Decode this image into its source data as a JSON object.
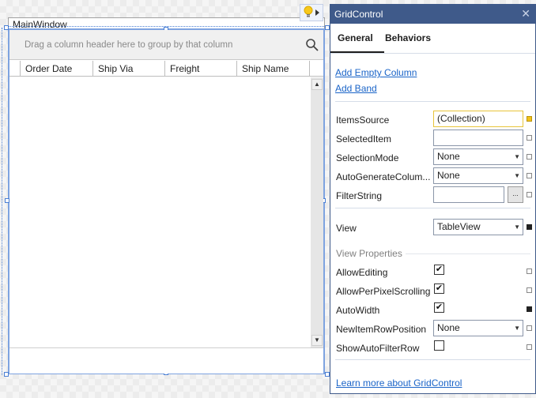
{
  "designer": {
    "window_title": "MainWindow",
    "group_panel_hint": "Drag a column header here to group by that column",
    "columns": [
      "Order Date",
      "Ship Via",
      "Freight",
      "Ship Name"
    ],
    "icons": {
      "search": "search-icon",
      "lightbulb": "lightbulb-icon",
      "expand": "triangle-right-icon",
      "scroll_up": "▲",
      "scroll_down": "▼"
    }
  },
  "panel": {
    "title": "GridControl",
    "close": "✕",
    "tabs": [
      {
        "label": "General",
        "active": true
      },
      {
        "label": "Behaviors",
        "active": false
      }
    ],
    "actions": [
      "Add Empty Column",
      "Add Band"
    ],
    "properties": [
      {
        "name": "ItemsSource",
        "value": "(Collection)",
        "editor": "text",
        "marker": "gold"
      },
      {
        "name": "SelectedItem",
        "value": "",
        "editor": "text",
        "marker": "empty"
      },
      {
        "name": "SelectionMode",
        "value": "None",
        "editor": "combo",
        "marker": "empty"
      },
      {
        "name": "AutoGenerateColum...",
        "value": "None",
        "editor": "combo",
        "marker": "empty"
      },
      {
        "name": "FilterString",
        "value": "",
        "editor": "text-ellipsis",
        "ellipsis": "...",
        "marker": "empty"
      }
    ],
    "view": {
      "name": "View",
      "value": "TableView",
      "marker": "set"
    },
    "view_properties_title": "View Properties",
    "view_properties": [
      {
        "name": "AllowEditing",
        "checked": true,
        "marker": "empty"
      },
      {
        "name": "AllowPerPixelScrolling",
        "checked": true,
        "marker": "empty"
      },
      {
        "name": "AutoWidth",
        "checked": true,
        "marker": "set"
      },
      {
        "name": "NewItemRowPosition",
        "value": "None",
        "editor": "combo",
        "marker": "empty"
      },
      {
        "name": "ShowAutoFilterRow",
        "checked": false,
        "marker": "empty"
      }
    ],
    "learn_more": "Learn more about GridControl",
    "check_glyph": "✔",
    "combo_glyph": "▼"
  }
}
